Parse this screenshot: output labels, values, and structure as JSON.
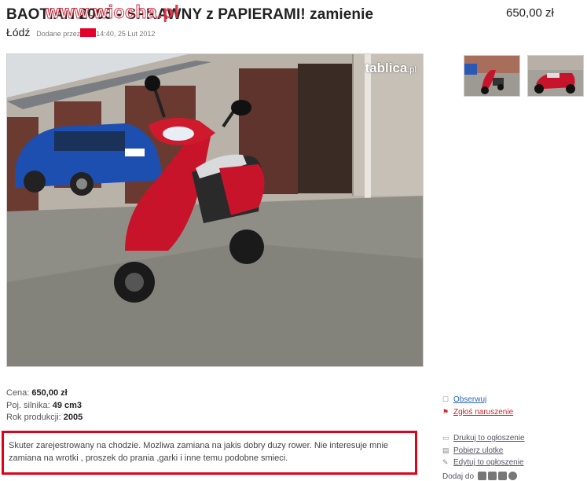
{
  "listing": {
    "title": "BAOTIAN 2005 - SPRAWNY z PAPIERAMI! zamienie",
    "price": "650,00 zł",
    "location": "Łódź",
    "added_by_label": "Dodane przez",
    "added_time": "14:40, 25 Lut 2012"
  },
  "watermark": {
    "text": "www.wiocha",
    "tld": ".pl"
  },
  "photo": {
    "brand": "tablica",
    "brand_tld": ".pl"
  },
  "specs": {
    "price_label": "Cena:",
    "price_value": "650,00 zł",
    "engine_label": "Poj. silnika:",
    "engine_value": "49 cm3",
    "year_label": "Rok produkcji:",
    "year_value": "2005"
  },
  "description": "Skuter zarejestrowany na chodzie. Mozliwa zamiana na jakis dobry duzy rower. Nie interesuje mnie zamiana na wrotki , proszek do prania ,garki i inne temu podobne smieci.",
  "actions": {
    "follow": "Obserwuj",
    "report": "Zgłoś naruszenie",
    "print": "Drukuj to ogłoszenie",
    "flyer": "Pobierz ulotke",
    "edit": "Edytuj to ogłoszenie",
    "share": "Dodaj do"
  },
  "icons": {
    "follow": "checkbox-icon",
    "report": "flag-icon",
    "print": "printer-icon",
    "flyer": "document-icon",
    "edit": "edit-icon"
  },
  "colors": {
    "highlight": "#e0001a",
    "link": "#2a66b5",
    "report_link": "#c8282f"
  }
}
